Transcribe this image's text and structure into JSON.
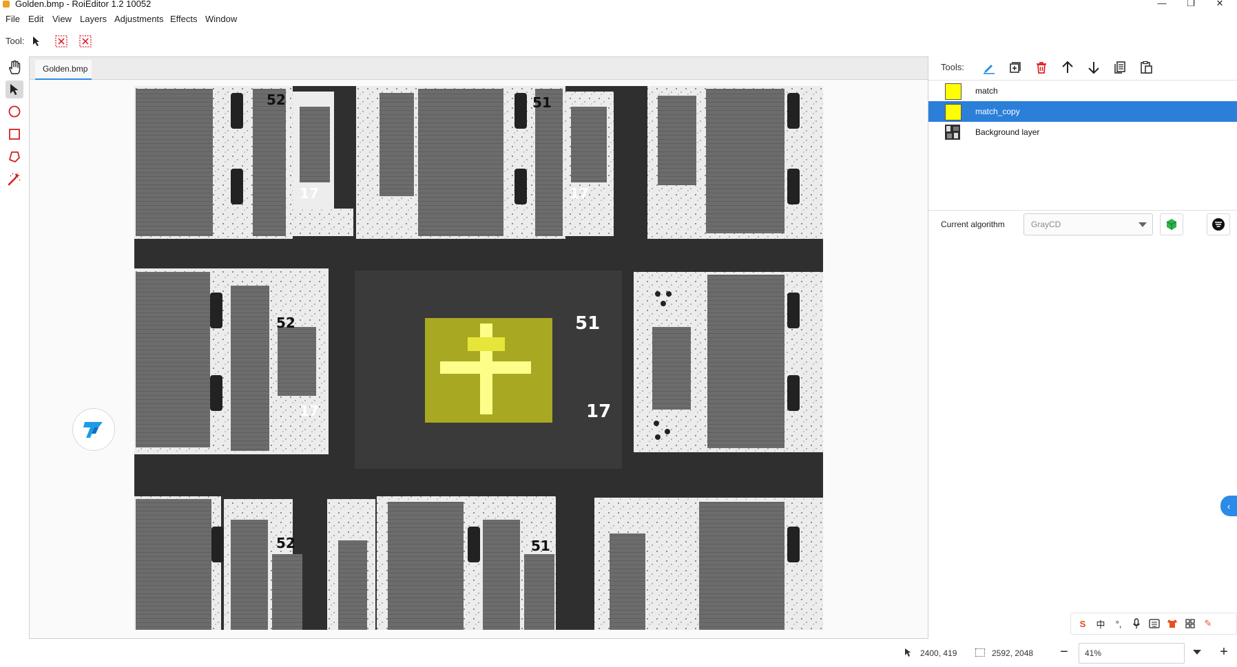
{
  "window": {
    "title": "Golden.bmp - RoiEditor 1.2 10052"
  },
  "menu": {
    "items": [
      "File",
      "Edit",
      "View",
      "Layers",
      "Adjustments",
      "Effects",
      "Window"
    ]
  },
  "toolbar": {
    "tool_label": "Tool:"
  },
  "left_tools": {
    "icons": [
      "hand-icon",
      "pointer-icon",
      "circle-icon",
      "rectangle-icon",
      "polygon-icon",
      "magic-wand-icon"
    ]
  },
  "document": {
    "tab_label": "Golden.bmp"
  },
  "canvas": {
    "pad_labels": {
      "top_left": "52",
      "top_mid": "51",
      "mid_left": "52",
      "bottom_left": "52",
      "bottom_mid": "51",
      "l17a": "17",
      "l17b": "17",
      "l17c": "17"
    },
    "center_num": "51",
    "center_num2": "17"
  },
  "right_panel": {
    "tools_label": "Tools:",
    "layers": [
      {
        "name": "match",
        "color": "#ffff00",
        "selected": false
      },
      {
        "name": "match_copy",
        "color": "#ffff00",
        "selected": true
      },
      {
        "name": "Background layer",
        "selected": false
      }
    ],
    "algorithm_label": "Current algorithm",
    "algorithm_value": "GrayCD"
  },
  "status": {
    "cursor": "2400, 419",
    "image_size": "2592, 2048",
    "zoom": "41%"
  },
  "colors": {
    "accent": "#2b8be8",
    "selection": "#2b7fd9",
    "roi": "#c8c81e",
    "delete": "#e02020"
  }
}
